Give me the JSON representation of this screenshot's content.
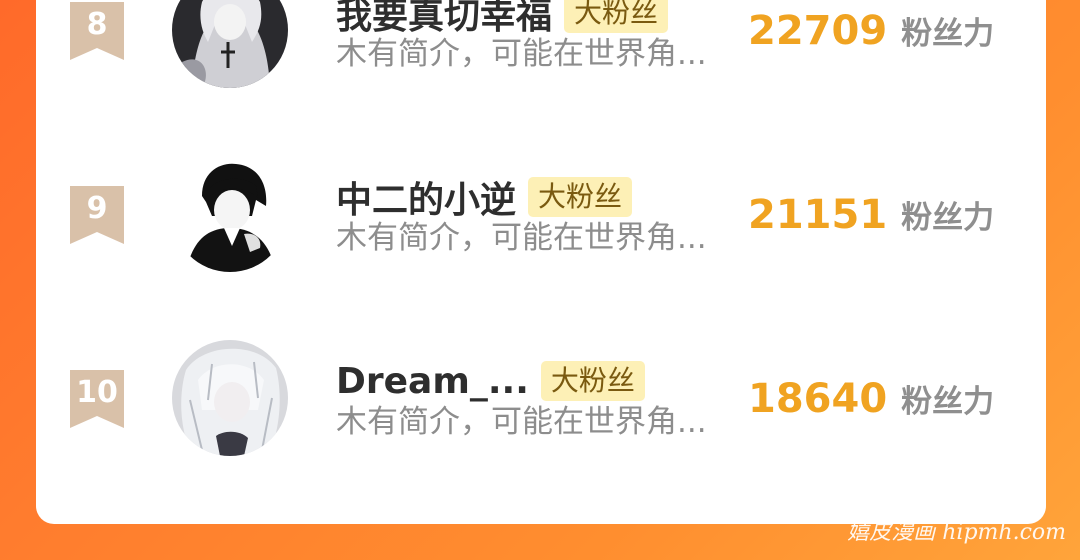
{
  "ranking": {
    "rows": [
      {
        "rank": "8",
        "name": "我要真切幸福",
        "badge": "大粉丝",
        "description": "木有简介，可能在世界角...",
        "score": "22709",
        "score_unit": "粉丝力"
      },
      {
        "rank": "9",
        "name": "中二的小逆",
        "badge": "大粉丝",
        "description": "木有简介，可能在世界角...",
        "score": "21151",
        "score_unit": "粉丝力"
      },
      {
        "rank": "10",
        "name": "Dream_...",
        "badge": "大粉丝",
        "description": "木有简介，可能在世界角...",
        "score": "18640",
        "score_unit": "粉丝力"
      }
    ]
  },
  "watermark": "嬉皮漫画 hipmh.com",
  "colors": {
    "background": "#ff7d2e",
    "score": "#f0a321",
    "badge_bg": "#fdf0b6",
    "rank_ribbon": "#d9c1a9"
  }
}
